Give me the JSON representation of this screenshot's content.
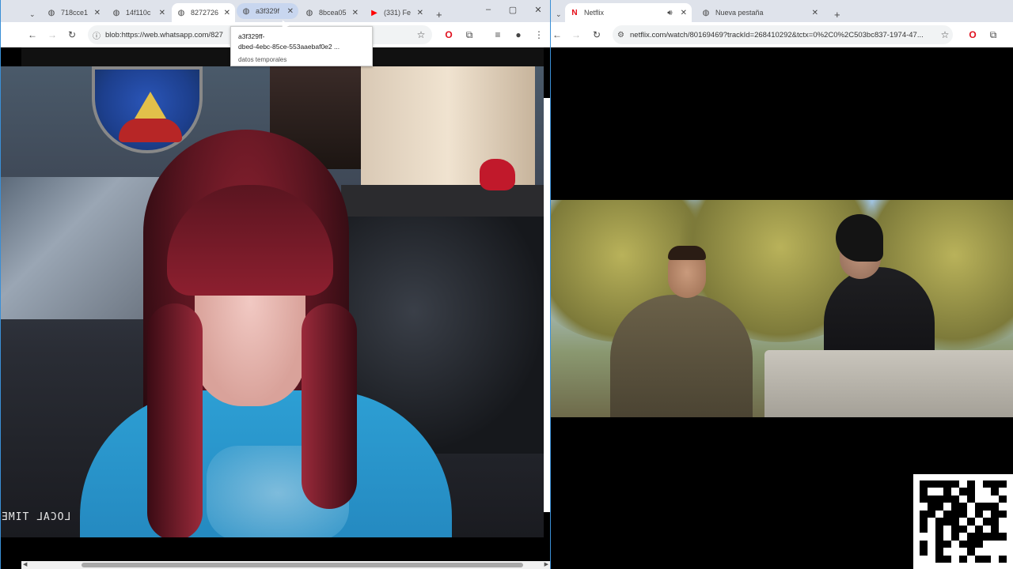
{
  "left_window": {
    "tabs": [
      {
        "title": "718cce1",
        "favicon": "globe-icon"
      },
      {
        "title": "14f110c",
        "favicon": "globe-icon"
      },
      {
        "title": "8272726",
        "favicon": "globe-icon"
      },
      {
        "title": "a3f329f",
        "favicon": "globe-icon"
      },
      {
        "title": "8bcea05",
        "favicon": "globe-icon"
      },
      {
        "title": "(331) Fe",
        "favicon": "youtube-icon"
      }
    ],
    "url": "blob:https://web.whatsapp.com/827",
    "tooltip": {
      "line1": "a3f329ff-",
      "line2": "dbed-4ebc-85ce-553aaebaf0e2 ...",
      "line3": "datos temporales"
    },
    "overlay_text": "LOCAL TIME"
  },
  "right_window": {
    "tabs": [
      {
        "title": "Netflix",
        "favicon": "netflix-icon"
      },
      {
        "title": "Nueva pestaña",
        "favicon": "globe-icon"
      }
    ],
    "url": "netflix.com/watch/80169469?trackId=268410292&tctx=0%2C0%2C503bc837-1974-47..."
  },
  "colors": {
    "accent": "#3a8fd6",
    "opera_red": "#e0101e",
    "netflix_red": "#e50914",
    "youtube_red": "#ff0000"
  }
}
